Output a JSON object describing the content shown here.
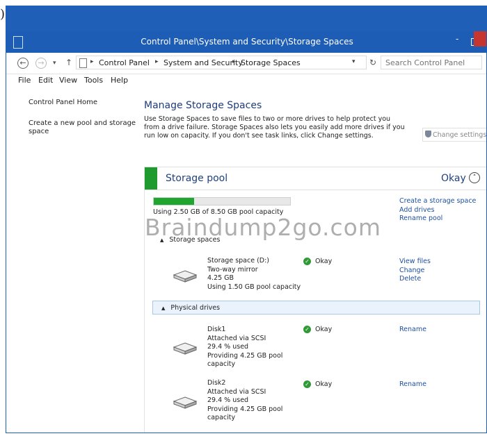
{
  "corner_glyph": ")",
  "window": {
    "title": "Control Panel\\System and Security\\Storage Spaces",
    "min_glyph": "-"
  },
  "address": {
    "crumbs": [
      "Control Panel",
      "System and Security",
      "Storage Spaces"
    ],
    "sep": "▸",
    "chevron": "▾",
    "back_glyph": "←",
    "forward_glyph": "→",
    "history_glyph": "▾",
    "up_glyph": "↑",
    "refresh_glyph": "↻",
    "search_placeholder": "Search Control Panel"
  },
  "menubar": {
    "items": [
      "File",
      "Edit",
      "View",
      "Tools",
      "Help"
    ]
  },
  "sidebar": {
    "home": "Control Panel Home",
    "create_line1": "Create a new pool and storage",
    "create_line2": "space"
  },
  "main": {
    "heading": "Manage Storage Spaces",
    "description": "Use Storage Spaces to save files to two or more drives to help protect you from a drive failure. Storage Spaces also lets you easily add more drives if you run low on capacity. If you don't see task links, click Change settings.",
    "change_settings": "Change settings"
  },
  "pool": {
    "title": "Storage pool",
    "status": "Okay",
    "collapse_glyph": "˄",
    "usage_fraction": 0.294,
    "usage_text": "Using 2.50 GB of 8.50 GB pool capacity",
    "actions": [
      "Create a storage space",
      "Add drives",
      "Rename pool"
    ],
    "watermark": "Braindump2go.com"
  },
  "storage_spaces": {
    "header": "Storage spaces",
    "tri": "▲",
    "item": {
      "name": "Storage space (D:)",
      "type": "Two-way mirror",
      "size": "4.25 GB",
      "usage": "Using 1.50 GB pool capacity",
      "status": "Okay",
      "actions": [
        "View files",
        "Change",
        "Delete"
      ]
    }
  },
  "physical_drives": {
    "header": "Physical drives",
    "tri": "▲",
    "drives": [
      {
        "name": "Disk1",
        "attach": "Attached via SCSI",
        "used": "29.4 % used",
        "providing1": "Providing 4.25 GB pool",
        "providing2": "capacity",
        "status": "Okay",
        "action": "Rename"
      },
      {
        "name": "Disk2",
        "attach": "Attached via SCSI",
        "used": "29.4 % used",
        "providing1": "Providing 4.25 GB pool",
        "providing2": "capacity",
        "status": "Okay",
        "action": "Rename"
      }
    ]
  },
  "check_glyph": "✓",
  "colors": {
    "titlebar": "#1e5db5",
    "accent_green": "#1e9a2e",
    "link_blue": "#1e4fa0",
    "heading_blue": "#1e3c7b"
  }
}
